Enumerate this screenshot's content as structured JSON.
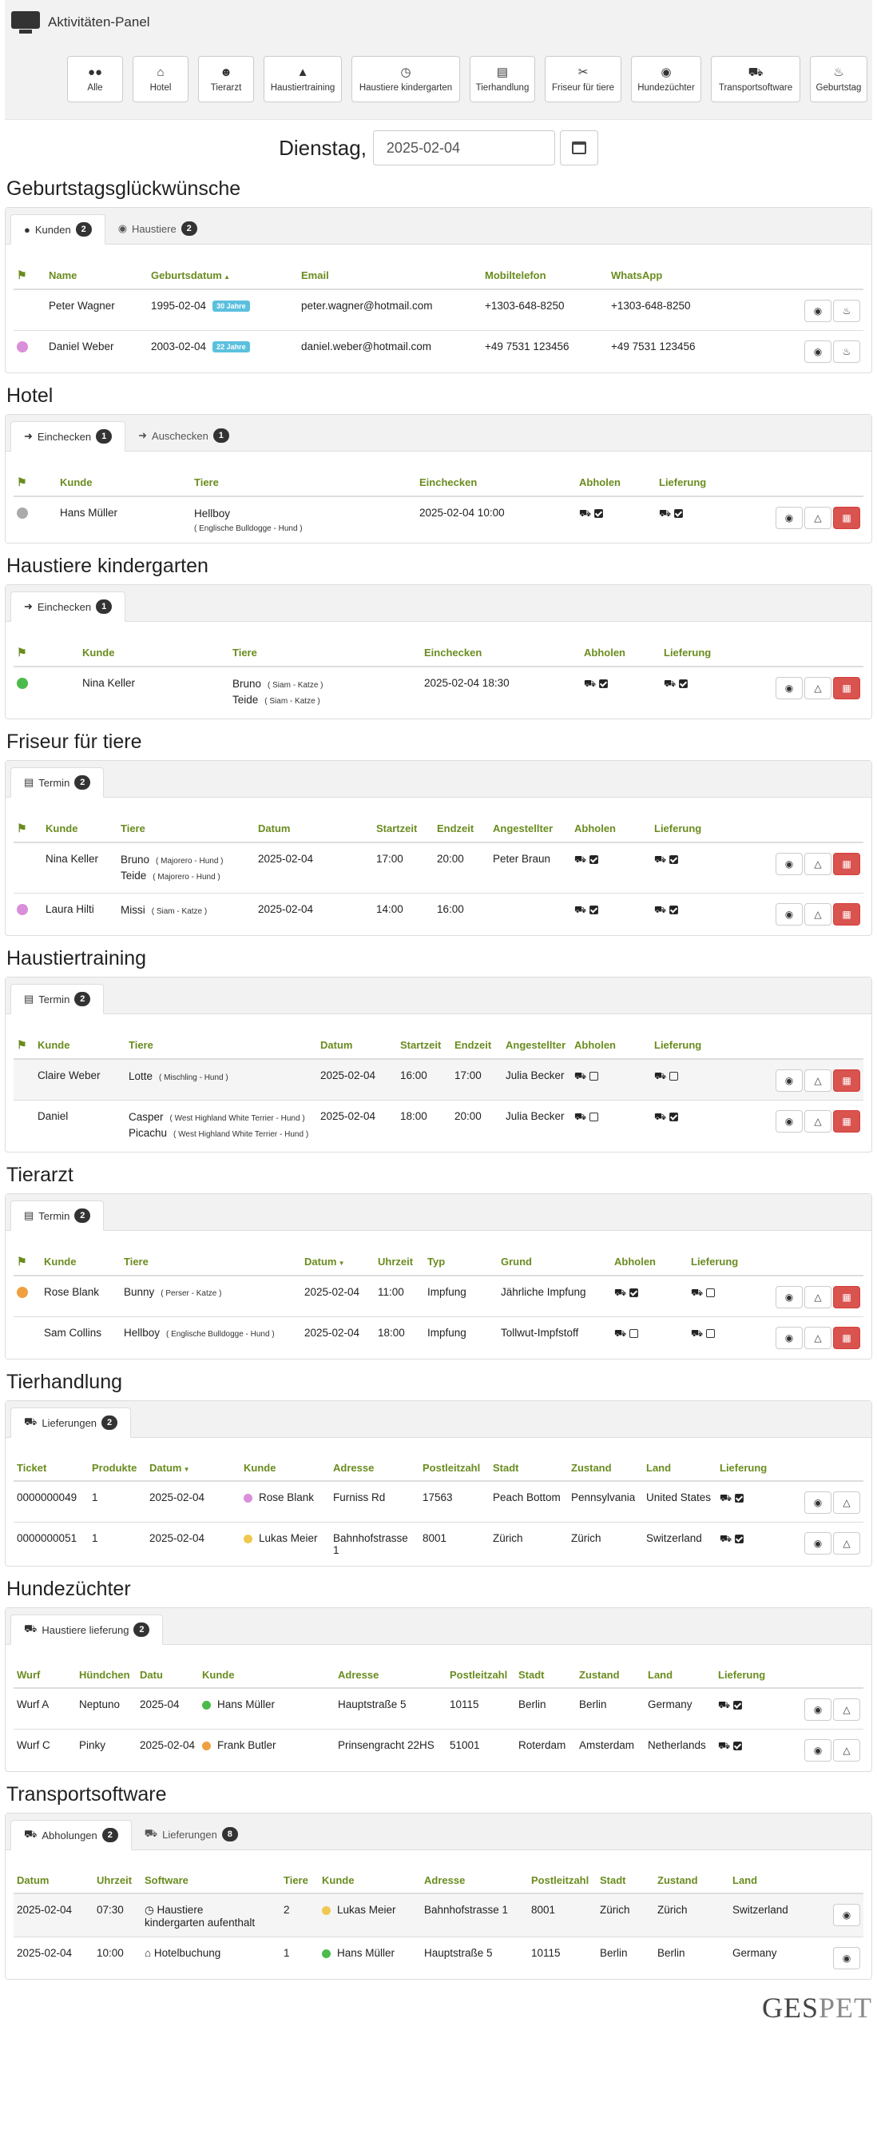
{
  "app": {
    "title": "Aktivitäten-Panel"
  },
  "nav": [
    {
      "label": "Alle",
      "icon": "users-icon"
    },
    {
      "label": "Hotel",
      "icon": "home-icon"
    },
    {
      "label": "Tierarzt",
      "icon": "user-md-icon"
    },
    {
      "label": "Haustiertraining",
      "icon": "graduation-cap-icon"
    },
    {
      "label": "Haustiere kindergarten",
      "icon": "clock-icon"
    },
    {
      "label": "Tierhandlung",
      "icon": "cart-icon"
    },
    {
      "label": "Friseur für tiere",
      "icon": "scissors-icon"
    },
    {
      "label": "Hundezüchter",
      "icon": "dog-icon"
    },
    {
      "label": "Transportsoftware",
      "icon": "truck-icon"
    },
    {
      "label": "Geburtstag",
      "icon": "cake-icon"
    }
  ],
  "date": {
    "label": "Dienstag,",
    "value": "2025-02-04"
  },
  "birthday": {
    "title": "Geburtstagsglückwünsche",
    "tabs": [
      {
        "label": "Kunden",
        "count": "2"
      },
      {
        "label": "Haustiere",
        "count": "2"
      }
    ],
    "headers": [
      "Name",
      "Geburtsdatum",
      "Email",
      "Mobiltelefon",
      "WhatsApp"
    ],
    "rows": [
      {
        "name": "Peter Wagner",
        "dob": "1995-02-04",
        "age": "30 Jahre",
        "email": "peter.wagner@hotmail.com",
        "mobile": "+1303-648-8250",
        "whatsapp": "+1303-648-8250",
        "dot": ""
      },
      {
        "name": "Daniel Weber",
        "dob": "2003-02-04",
        "age": "22 Jahre",
        "email": "daniel.weber@hotmail.com",
        "mobile": "+49 7531 123456",
        "whatsapp": "+49 7531 123456",
        "dot": "#d98fd9"
      }
    ]
  },
  "hotel": {
    "title": "Hotel",
    "tabs": [
      {
        "label": "Einchecken",
        "count": "1"
      },
      {
        "label": "Auschecken",
        "count": "1"
      }
    ],
    "headers": [
      "Kunde",
      "Tiere",
      "Einchecken",
      "Abholen",
      "Lieferung"
    ],
    "rows": [
      {
        "customer": "Hans Müller",
        "pet": "Hellboy",
        "breed": "( Englische Bulldogge - Hund )",
        "checkin": "2025-02-04 10:00",
        "dot": "#aaaaaa"
      }
    ]
  },
  "kindergarten": {
    "title": "Haustiere kindergarten",
    "tabs": [
      {
        "label": "Einchecken",
        "count": "1"
      }
    ],
    "headers": [
      "Kunde",
      "Tiere",
      "Einchecken",
      "Abholen",
      "Lieferung"
    ],
    "rows": [
      {
        "customer": "Nina Keller",
        "pet1": "Bruno",
        "breed1": "( Siam - Katze )",
        "pet2": "Teide",
        "breed2": "( Siam - Katze )",
        "checkin": "2025-02-04 18:30",
        "dot": "#4cbb4c"
      }
    ]
  },
  "groomer": {
    "title": "Friseur für tiere",
    "tabs": [
      {
        "label": "Termin",
        "count": "2"
      }
    ],
    "headers": [
      "Kunde",
      "Tiere",
      "Datum",
      "Startzeit",
      "Endzeit",
      "Angestellter",
      "Abholen",
      "Lieferung"
    ],
    "rows": [
      {
        "customer": "Nina Keller",
        "pet1": "Bruno",
        "breed1": "( Majorero - Hund )",
        "pet2": "Teide",
        "breed2": "( Majorero - Hund )",
        "date": "2025-02-04",
        "start": "17:00",
        "end": "20:00",
        "staff": "Peter Braun",
        "dot": ""
      },
      {
        "customer": "Laura Hilti",
        "pet1": "Missi",
        "breed1": "( Siam - Katze )",
        "date": "2025-02-04",
        "start": "14:00",
        "end": "16:00",
        "staff": "",
        "dot": "#d98fd9"
      }
    ]
  },
  "training": {
    "title": "Haustiertraining",
    "tabs": [
      {
        "label": "Termin",
        "count": "2"
      }
    ],
    "headers": [
      "Kunde",
      "Tiere",
      "Datum",
      "Startzeit",
      "Endzeit",
      "Angestellter",
      "Abholen",
      "Lieferung"
    ],
    "rows": [
      {
        "customer": "Claire  Weber",
        "pet1": "Lotte",
        "breed1": "( Mischling - Hund )",
        "date": "2025-02-04",
        "start": "16:00",
        "end": "17:00",
        "staff": "Julia Becker"
      },
      {
        "customer": "Daniel",
        "pet1": "Casper",
        "breed1": "( West Highland White Terrier - Hund )",
        "pet2": "Picachu",
        "breed2": "( West Highland White Terrier - Hund )",
        "date": "2025-02-04",
        "start": "18:00",
        "end": "20:00",
        "staff": "Julia Becker"
      }
    ]
  },
  "vet": {
    "title": "Tierarzt",
    "tabs": [
      {
        "label": "Termin",
        "count": "2"
      }
    ],
    "headers": [
      "Kunde",
      "Tiere",
      "Datum",
      "Uhrzeit",
      "Typ",
      "Grund",
      "Abholen",
      "Lieferung"
    ],
    "rows": [
      {
        "customer": "Rose Blank",
        "pet": "Bunny",
        "breed": "( Perser - Katze )",
        "date": "2025-02-04",
        "time": "11:00",
        "type": "Impfung",
        "reason": "Jährliche Impfung",
        "dot": "#f0a040"
      },
      {
        "customer": "Sam Collins",
        "pet": "Hellboy",
        "breed": "( Englische   Bulldogge - Hund )",
        "date": "2025-02-04",
        "time": "18:00",
        "type": "Impfung",
        "reason": "Tollwut-Impfstoff",
        "dot": ""
      }
    ]
  },
  "shop": {
    "title": "Tierhandlung",
    "tabs": [
      {
        "label": "Lieferungen",
        "count": "2"
      }
    ],
    "headers": [
      "Ticket",
      "Produkte",
      "Datum",
      "Kunde",
      "Adresse",
      "Postleitzahl",
      "Stadt",
      "Zustand",
      "Land",
      "Lieferung"
    ],
    "rows": [
      {
        "ticket": "0000000049",
        "products": "1",
        "date": "2025-02-04",
        "customer": "Rose  Blank",
        "address": "Furniss Rd",
        "zip": "17563",
        "city": "Peach Bottom",
        "state": "Pennsylvania",
        "country": "United States",
        "dot": "#d98fd9"
      },
      {
        "ticket": "0000000051",
        "products": "1",
        "date": "2025-02-04",
        "customer": "Lukas Meier",
        "address": "Bahnhofstrasse 1",
        "zip": "8001",
        "city": "Zürich",
        "state": "Zürich",
        "country": "Switzerland",
        "dot": "#f0c850"
      }
    ]
  },
  "breeder": {
    "title": "Hundezüchter",
    "tabs": [
      {
        "label": "Haustiere lieferung",
        "count": "2"
      }
    ],
    "headers": [
      "Wurf",
      "Hündchen",
      "Datu",
      "Kunde",
      "Adresse",
      "Postleitzahl",
      "Stadt",
      "Zustand",
      "Land",
      "Lieferung"
    ],
    "rows": [
      {
        "litter": "Wurf A",
        "puppy": "Neptuno",
        "date": "2025-04",
        "customer": "Hans Müller",
        "address": "Hauptstraße 5",
        "zip": "10115",
        "city": "Berlin",
        "state": "Berlin",
        "country": "Germany",
        "dot": "#4cbb4c"
      },
      {
        "litter": "Wurf C",
        "puppy": "Pinky",
        "date": "2025-02-04",
        "customer": "Frank  Butler",
        "address": "Prinsengracht 22HS",
        "zip": "51001",
        "city": "Roterdam",
        "state": "Amsterdam",
        "country": "Netherlands",
        "dot": "#f0a040"
      }
    ]
  },
  "transport": {
    "title": "Transportsoftware",
    "tabs": [
      {
        "label": "Abholungen",
        "count": "2"
      },
      {
        "label": "Lieferungen",
        "count": "8"
      }
    ],
    "headers": [
      "Datum",
      "Uhrzeit",
      "Software",
      "Tiere",
      "Kunde",
      "Adresse",
      "Postleitzahl",
      "Stadt",
      "Zustand",
      "Land"
    ],
    "rows": [
      {
        "date": "2025-02-04",
        "time": "07:30",
        "software_line1": "Haustiere",
        "software_line2": "kindergarten aufenthalt",
        "pets": "2",
        "customer": "Lukas Meier",
        "address": "Bahnhofstrasse 1",
        "zip": "8001",
        "city": "Zürich",
        "state": "Zürich",
        "country": "Switzerland",
        "dot": "#f0c850"
      },
      {
        "date": "2025-02-04",
        "time": "10:00",
        "software_line1": "Hotelbuchung",
        "pets": "1",
        "customer": "Hans  Müller",
        "address": "Hauptstraße 5",
        "zip": "10115",
        "city": "Berlin",
        "state": "Berlin",
        "country": "Germany",
        "dot": "#4cbb4c"
      }
    ]
  },
  "logo": {
    "part1": "GES",
    "part2": "PET"
  }
}
